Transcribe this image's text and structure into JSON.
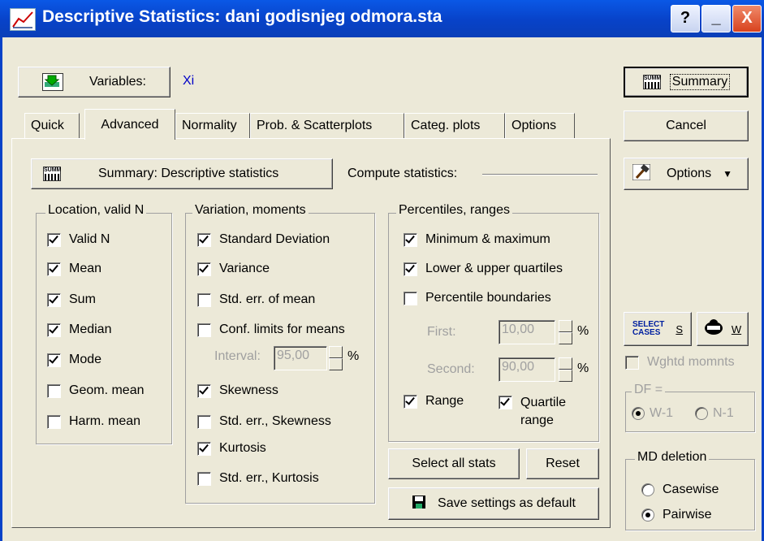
{
  "window": {
    "title": "Descriptive Statistics: dani godisnjeg odmora.sta"
  },
  "titlebar_buttons": {
    "help": "?",
    "minimize": "_",
    "close": "X"
  },
  "variables": {
    "button_label": "Variables:",
    "value": "Xi"
  },
  "tabs": [
    {
      "label": "Quick"
    },
    {
      "label": "Advanced"
    },
    {
      "label": "Normality"
    },
    {
      "label": "Prob. & Scatterplots"
    },
    {
      "label": "Categ. plots"
    },
    {
      "label": "Options"
    }
  ],
  "summary_desc_button": "Summary: Descriptive statistics",
  "compute_label": "Compute statistics:",
  "location_group": {
    "title": "Location, valid N",
    "items": [
      {
        "label": "Valid N",
        "checked": true
      },
      {
        "label": "Mean",
        "checked": true
      },
      {
        "label": "Sum",
        "checked": true
      },
      {
        "label": "Median",
        "checked": true
      },
      {
        "label": "Mode",
        "checked": true
      },
      {
        "label": "Geom. mean",
        "checked": false
      },
      {
        "label": "Harm. mean",
        "checked": false
      }
    ]
  },
  "variation_group": {
    "title": "Variation, moments",
    "items": [
      {
        "label": "Standard Deviation",
        "checked": true
      },
      {
        "label": "Variance",
        "checked": true
      },
      {
        "label": "Std. err. of mean",
        "checked": false
      },
      {
        "label": "Conf. limits for means",
        "checked": false
      },
      {
        "label": "Skewness",
        "checked": true
      },
      {
        "label": "Std. err., Skewness",
        "checked": false
      },
      {
        "label": "Kurtosis",
        "checked": true
      },
      {
        "label": "Std. err., Kurtosis",
        "checked": false
      }
    ],
    "interval_label": "Interval:",
    "interval_value": "95,00",
    "interval_unit": "%"
  },
  "percentiles_group": {
    "title": "Percentiles, ranges",
    "items": [
      {
        "label": "Minimum & maximum",
        "checked": true
      },
      {
        "label": "Lower & upper quartiles",
        "checked": true
      },
      {
        "label": "Percentile boundaries",
        "checked": false
      }
    ],
    "first_label": "First:",
    "first_value": "10,00",
    "second_label": "Second:",
    "second_value": "90,00",
    "unit": "%",
    "range": {
      "label": "Range",
      "checked": true
    },
    "quartile_range": {
      "label_line1": "Quartile",
      "label_line2": "range",
      "checked": true
    }
  },
  "buttons": {
    "select_all": "Select all stats",
    "reset": "Reset",
    "save_default": "Save settings as default",
    "summary": "Summary",
    "cancel": "Cancel",
    "options": "Options",
    "select_cases_icon_line1": "SELECT",
    "select_cases_icon_line2": "CASES",
    "select_cases_key": "S",
    "weight_key": "W"
  },
  "right_panel": {
    "wghtd_momnts": "Wghtd momnts",
    "df_title": "DF =",
    "df_options": [
      "W-1",
      "N-1"
    ],
    "md_title": "MD deletion",
    "md_options": [
      {
        "label": "Casewise",
        "selected": false
      },
      {
        "label": "Pairwise",
        "selected": true
      }
    ]
  },
  "summary_icon_text": "SUMM"
}
